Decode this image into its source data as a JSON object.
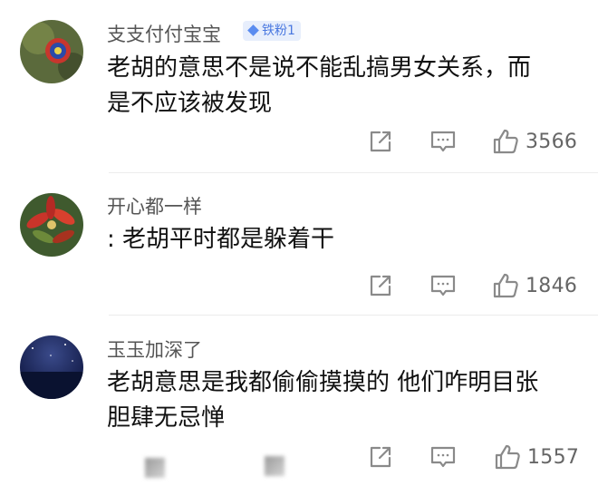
{
  "comments": [
    {
      "username": "支支付付宝宝",
      "badge": "铁粉1",
      "text_lines": [
        "老胡的意思不是说不能乱搞男女关系，而",
        "是不应该被发现"
      ],
      "likes": "3566"
    },
    {
      "username": "开心都一样",
      "badge": "",
      "text_lines": [
        ": 老胡平时都是躲着干"
      ],
      "likes": "1846"
    },
    {
      "username": "玉玉加深了",
      "badge": "",
      "text_lines": [
        "老胡意思是我都偷偷摸摸的 他们咋明目张",
        "胆肆无忌惮"
      ],
      "likes": "1557"
    }
  ],
  "icons": {
    "share": "share-icon",
    "reply": "comment-icon",
    "like": "thumbs-up-icon"
  },
  "colors": {
    "badge_bg": "#e7eefc",
    "badge_text": "#4a78e0",
    "username": "#555555",
    "icon": "#8a8a8a"
  }
}
